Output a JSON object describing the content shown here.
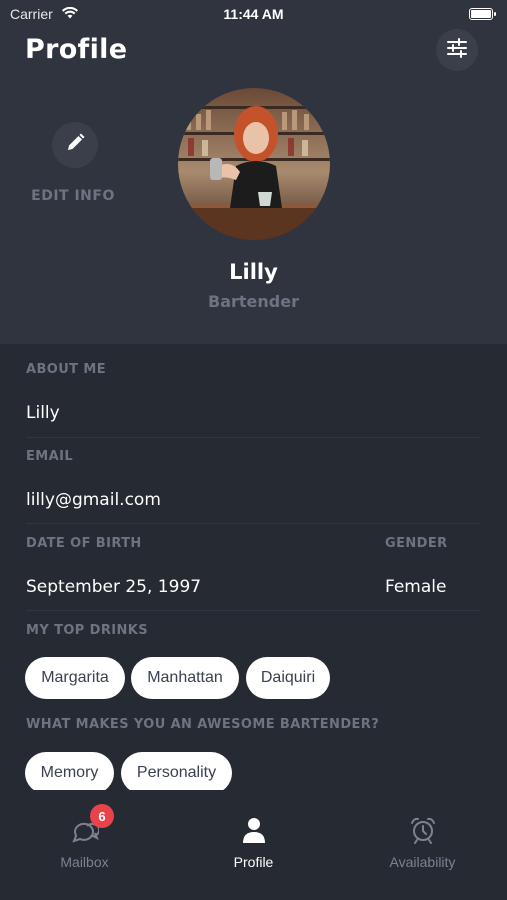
{
  "status_bar": {
    "carrier": "Carrier",
    "time": "11:44 AM"
  },
  "header": {
    "title": "Profile",
    "edit_label": "EDIT INFO",
    "name": "Lilly",
    "role": "Bartender"
  },
  "details": {
    "about_label": "ABOUT ME",
    "about_value": "Lilly",
    "email_label": "EMAIL",
    "email_value": "lilly@gmail.com",
    "dob_label": "DATE OF BIRTH",
    "dob_value": "September 25, 1997",
    "gender_label": "GENDER",
    "gender_value": "Female",
    "drinks_label": "MY TOP DRINKS",
    "drinks": [
      "Margarita",
      "Manhattan",
      "Daiquiri"
    ],
    "awesome_label": "WHAT MAKES YOU AN AWESOME BARTENDER?",
    "qualities": [
      "Memory",
      "Personality"
    ]
  },
  "tabs": [
    {
      "label": "Mailbox",
      "icon": "chat-bubbles-icon",
      "badge": "6",
      "active": false
    },
    {
      "label": "Profile",
      "icon": "person-icon",
      "active": true
    },
    {
      "label": "Availability",
      "icon": "alarm-clock-icon",
      "active": false
    }
  ],
  "colors": {
    "header_bg": "#2f343f",
    "body_bg": "#252a33",
    "muted_text": "#6d7381",
    "chip_bg": "#ffffff",
    "badge": "#e8434a"
  }
}
